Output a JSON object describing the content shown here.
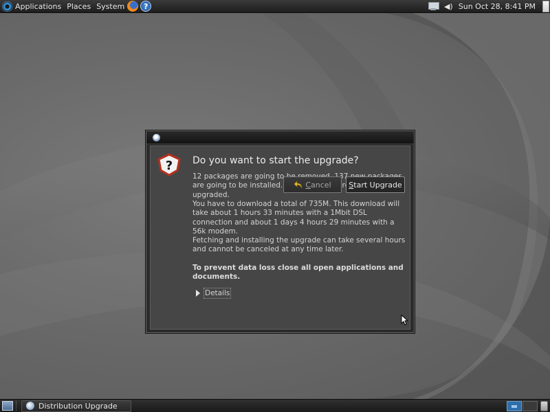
{
  "top_panel": {
    "menus": [
      "Applications",
      "Places",
      "System"
    ],
    "clock": "Sun Oct 28,  8:41 PM",
    "icons": {
      "applications": "distribution-logo-icon",
      "firefox": "firefox-icon",
      "help": "help-icon",
      "network": "network-icon",
      "volume": "volume-icon",
      "shutdown": "shutdown-icon"
    }
  },
  "dialog": {
    "heading": "Do you want to start the upgrade?",
    "paragraphs": [
      "12 packages are going to be removed. 137 new packages are going to be installed. 960 packages are going to be upgraded.",
      "You have to download a total of 735M. This download will take about 1 hours 33 minutes with a 1Mbit DSL connection and about 1 days 4 hours 29 minutes with a 56k modem.",
      "Fetching and installing the upgrade can take several hours and cannot be canceled at any time later."
    ],
    "warning": "To prevent data loss close all open applications and documents.",
    "details_label": "Details",
    "cancel_mnemonic": "C",
    "cancel_rest": "ancel",
    "start_mnemonic": "S",
    "start_rest": "tart Upgrade",
    "icon": "question-icon"
  },
  "bottom_panel": {
    "task_label": "Distribution Upgrade",
    "icons": {
      "show_desktop": "show-desktop-icon",
      "task": "upgrade-app-icon",
      "trash": "trash-icon"
    }
  },
  "colors": {
    "panel": "#1e1e1e",
    "dialog_bg": "#464646",
    "question_icon_red": "#b5311e",
    "text": "#d4d4d4"
  }
}
